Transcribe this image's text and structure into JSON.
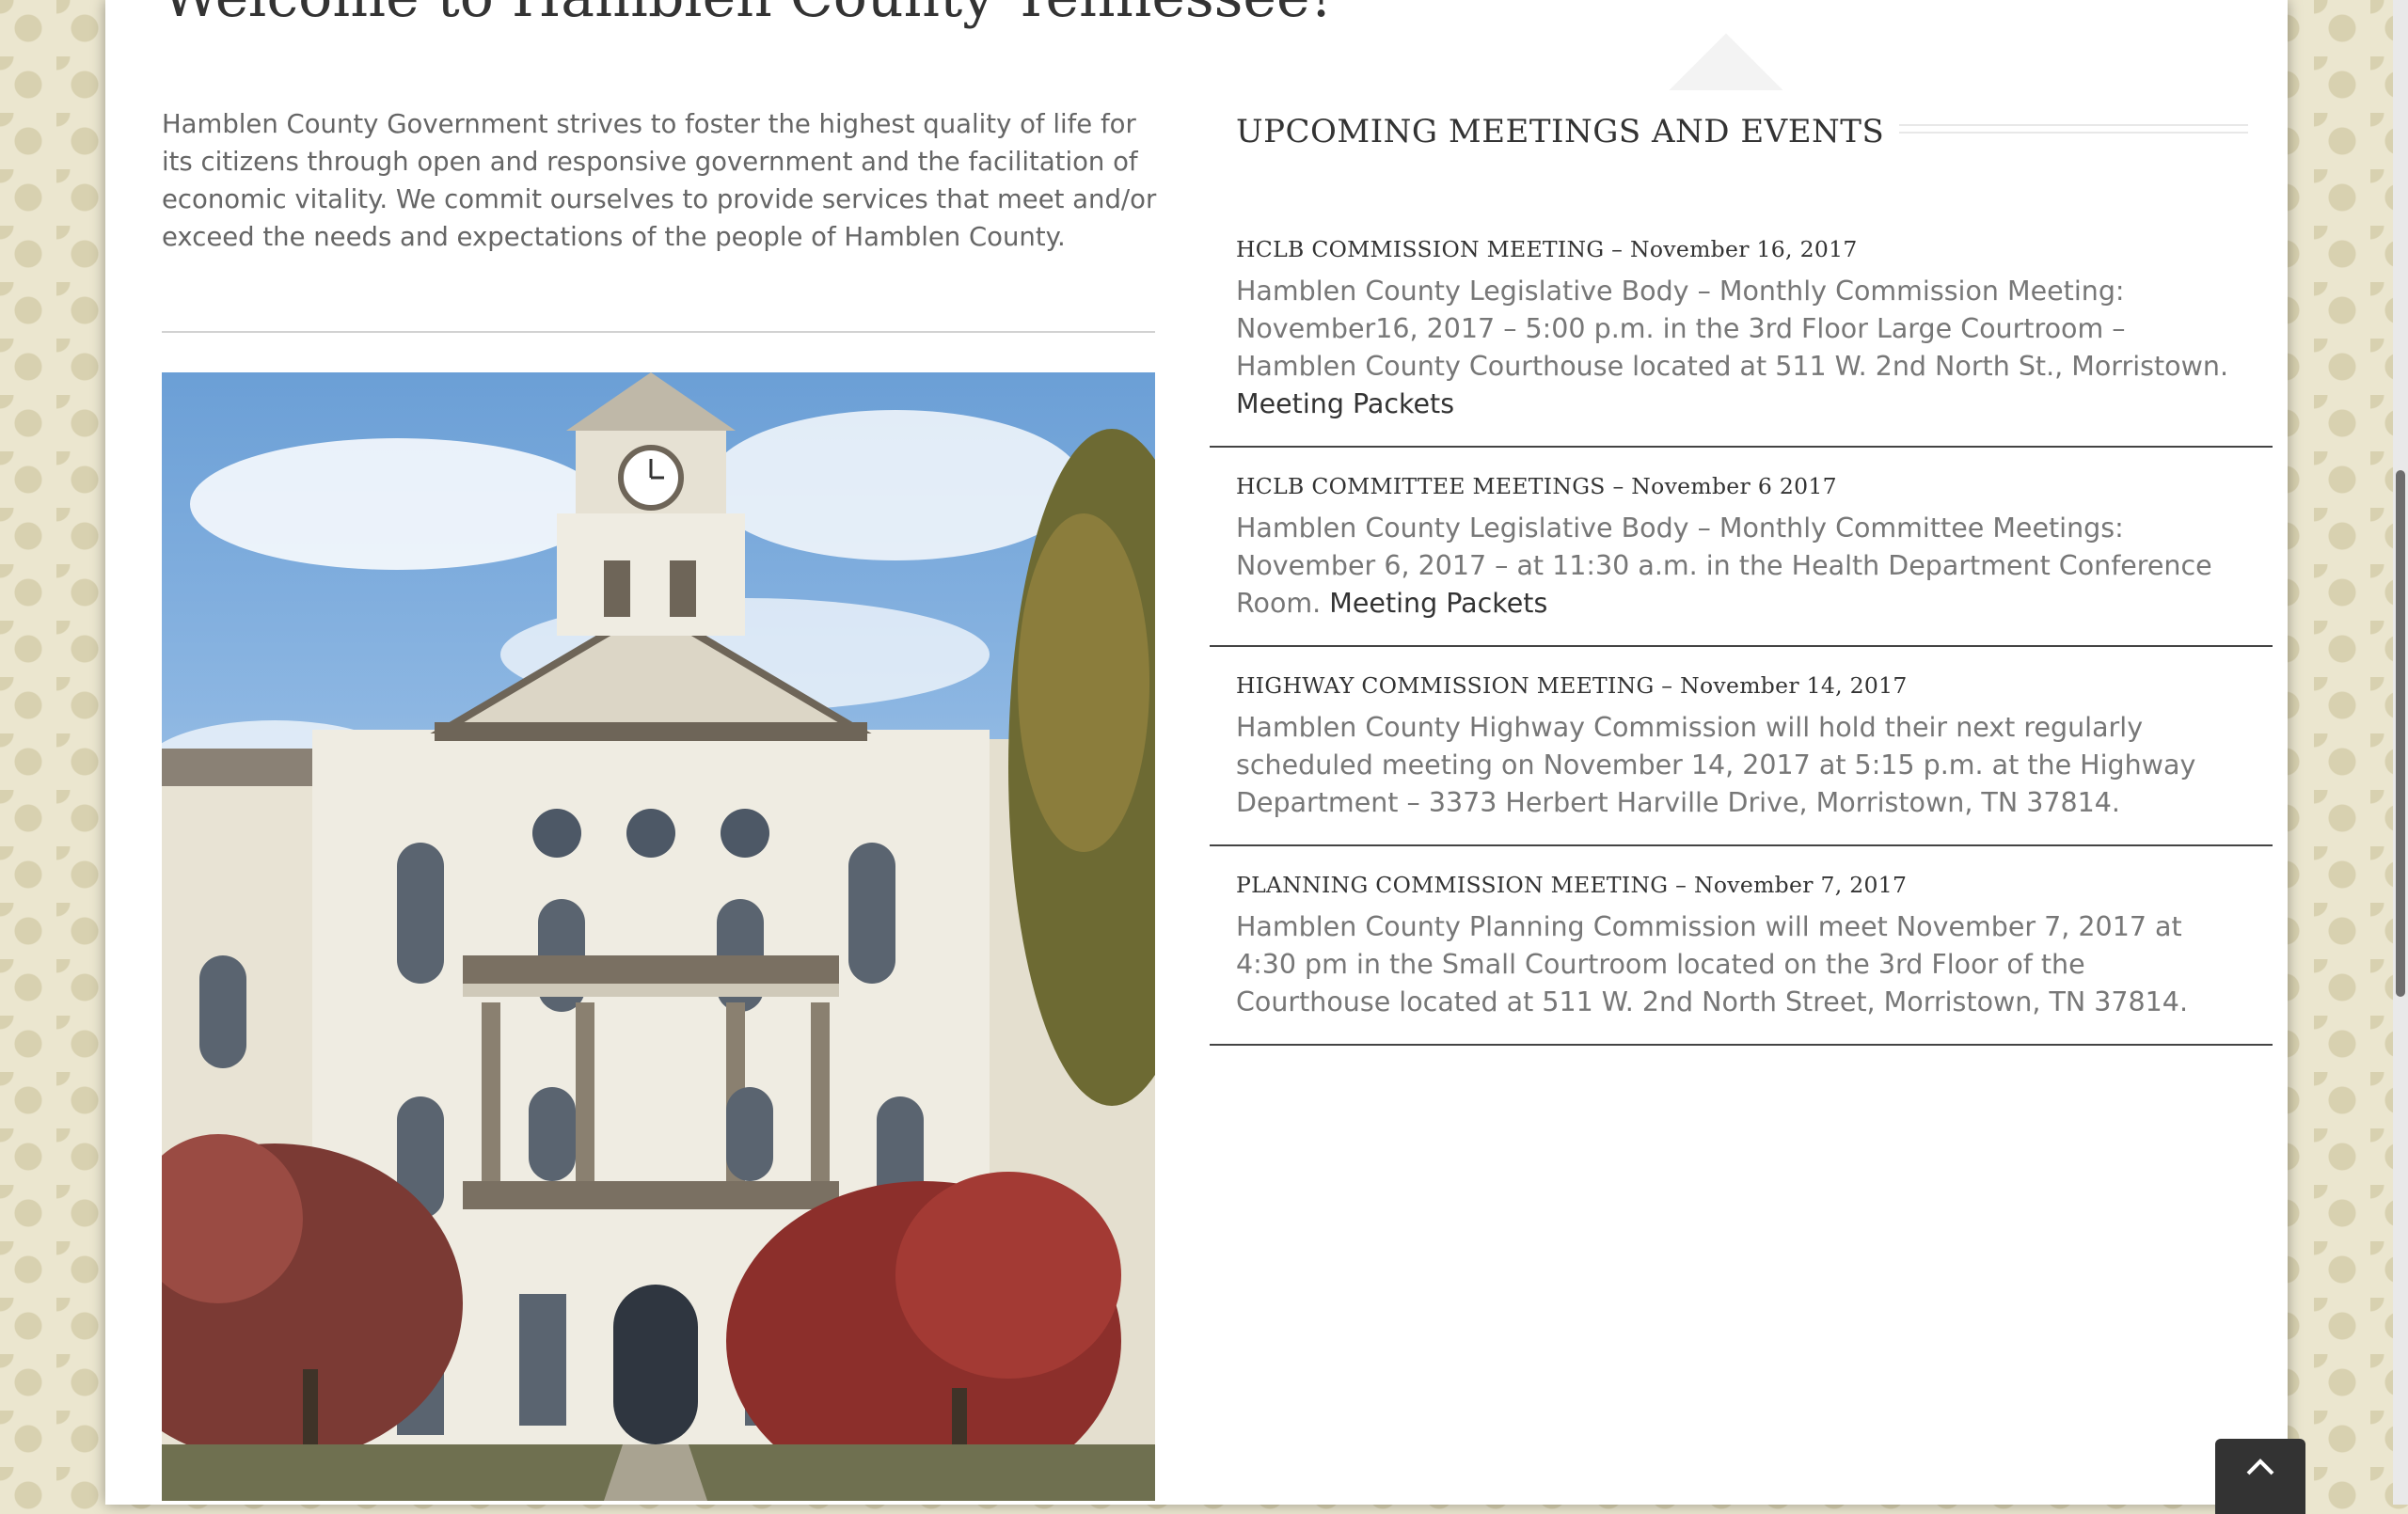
{
  "welcome": {
    "title": "Welcome to Hamblen County Tennessee!",
    "intro": "Hamblen County Government strives to foster the highest quality of life for its citizens through open and responsive government and the facilitation of economic vitality. We commit ourselves to provide services that meet and/or exceed the needs and expectations of the people of Hamblen County."
  },
  "photo": {
    "icon": "courthouse-photo"
  },
  "events": {
    "heading": "UPCOMING MEETINGS AND EVENTS",
    "items": [
      {
        "title": "HCLB COMMISSION MEETING – November 16, 2017",
        "description": "Hamblen County Legislative Body – Monthly Commission Meeting: November16, 2017 – 5:00 p.m. in the 3rd Floor Large Courtroom – Hamblen County Courthouse located at 511 W. 2nd North St., Morristown.",
        "link": "Meeting Packets"
      },
      {
        "title": "HCLB COMMITTEE MEETINGS – November 6 2017",
        "description": "Hamblen County Legislative Body – Monthly Committee Meetings: November 6, 2017 – at 11:30 a.m. in the Health Department Conference Room.",
        "link": "Meeting Packets"
      },
      {
        "title": "HIGHWAY COMMISSION MEETING – November 14, 2017",
        "description": "Hamblen County Highway Commission will hold their next regularly scheduled meeting on November 14, 2017 at 5:15 p.m. at the Highway Department – 3373 Herbert Harville Drive, Morristown, TN 37814.",
        "link": ""
      },
      {
        "title": "PLANNING COMMISSION MEETING – November 7, 2017",
        "description": "Hamblen County Planning Commission will meet November 7, 2017 at 4:30 pm in the Small Courtroom located on the 3rd Floor of the Courthouse located at 511 W. 2nd North Street, Morristown, TN 37814.",
        "link": ""
      }
    ]
  },
  "controls": {
    "to_top_icon": "chevron-up-icon"
  },
  "colors": {
    "page_bg": "#ebe6cf",
    "text": "#666666",
    "heading": "#333333",
    "rule": "#444444"
  }
}
